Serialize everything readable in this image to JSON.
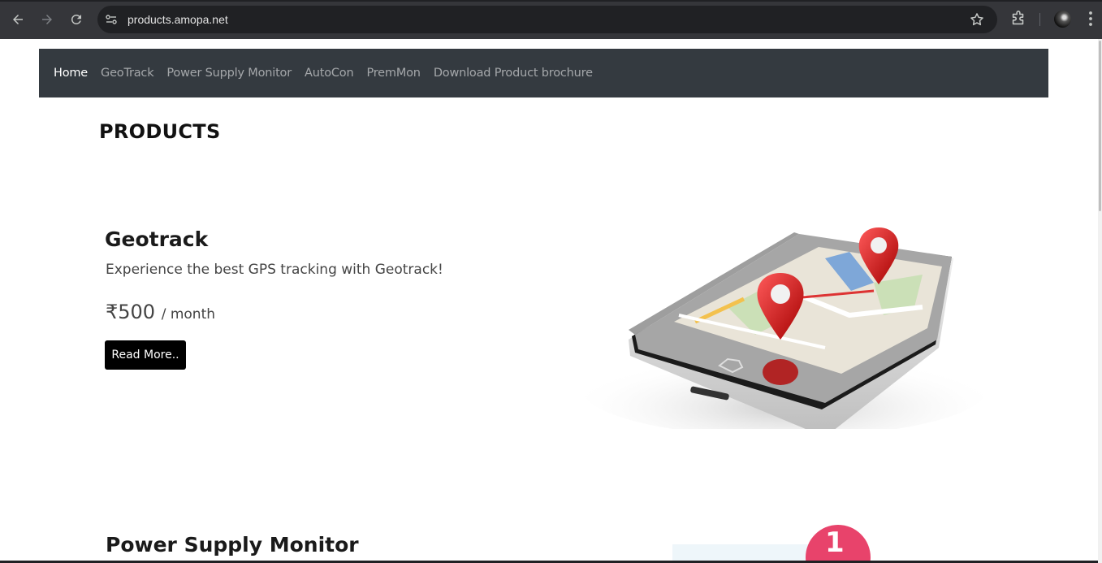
{
  "browser": {
    "url": "products.amopa.net"
  },
  "nav": {
    "items": [
      "Home",
      "GeoTrack",
      "Power Supply Monitor",
      "AutoCon",
      "PremMon",
      "Download Product brochure"
    ],
    "active": "Home"
  },
  "page": {
    "heading": "PRODUCTS"
  },
  "products": [
    {
      "title": "Geotrack",
      "description": "Experience the best GPS tracking with Geotrack!",
      "price": "₹500",
      "per": "/ month",
      "button": "Read More.."
    },
    {
      "title": "Power Supply Monitor",
      "image_badge": "1"
    }
  ],
  "colors": {
    "navbar_bg": "#343a40",
    "button_bg": "#000000",
    "pin_red": "#d7141a"
  }
}
